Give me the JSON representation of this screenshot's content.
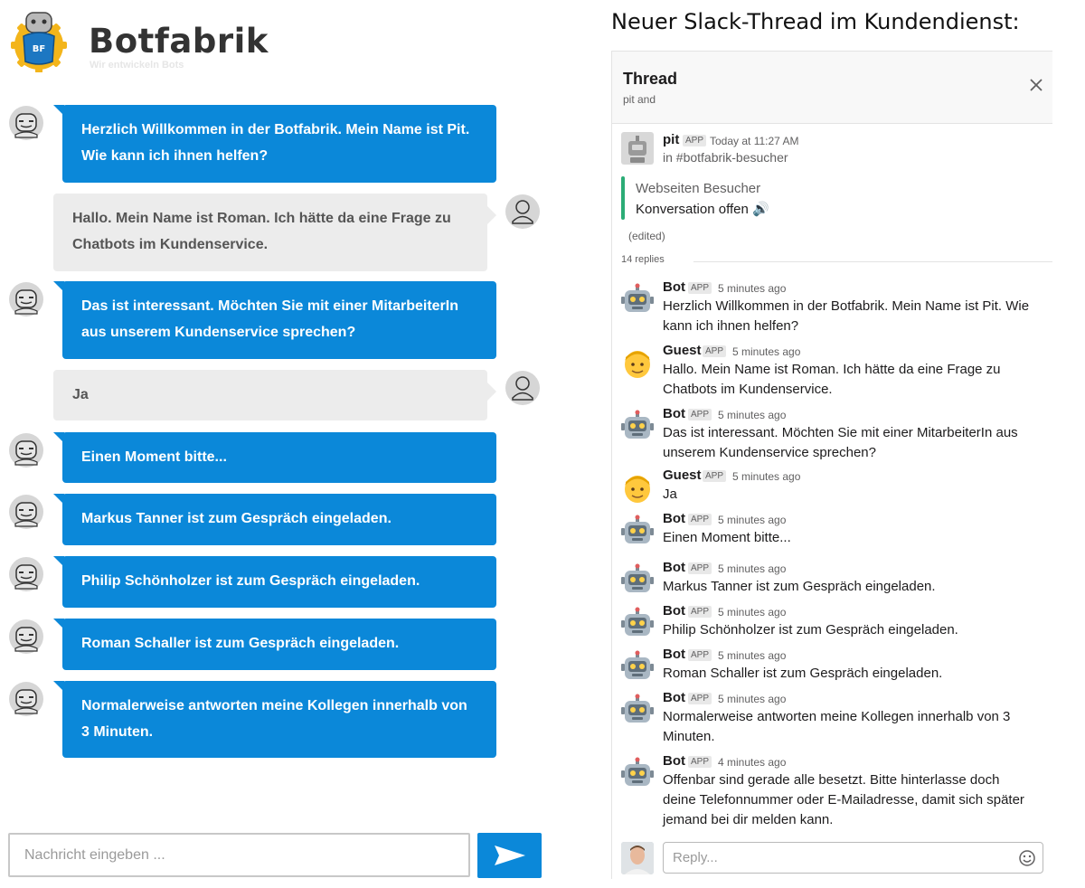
{
  "brand": {
    "name": "Botfabrik",
    "tagline": "Wir entwickeln Bots",
    "logo_text": "BF"
  },
  "chat": {
    "messages": [
      {
        "from": "bot",
        "text": "Herzlich Willkommen in der Botfabrik. Mein Name ist Pit. Wie kann ich ihnen helfen?"
      },
      {
        "from": "user",
        "text": "Hallo. Mein Name ist Roman. Ich hätte da eine Frage zu Chatbots im Kundenservice."
      },
      {
        "from": "bot",
        "text": "Das ist interessant. Möchten Sie mit einer MitarbeiterIn aus unserem Kundenservice sprechen?"
      },
      {
        "from": "user",
        "text": "Ja"
      },
      {
        "from": "bot",
        "text": "Einen Moment bitte..."
      },
      {
        "from": "bot",
        "text": "Markus Tanner ist zum Gespräch eingeladen."
      },
      {
        "from": "bot",
        "text": "Philip Schönholzer ist zum Gespräch eingeladen."
      },
      {
        "from": "bot",
        "text": "Roman Schaller ist zum Gespräch eingeladen."
      },
      {
        "from": "bot",
        "text": "Normalerweise antworten meine Kollegen innerhalb von 3 Minuten."
      }
    ],
    "input_placeholder": "Nachricht eingeben ...",
    "colors": {
      "bot_bubble": "#0b88d9",
      "user_bubble": "#ececec"
    }
  },
  "slack": {
    "heading": "Neuer Slack-Thread im Kundendienst:",
    "thread_title": "Thread",
    "thread_subtitle": "pit and",
    "root": {
      "name": "pit",
      "badge": "APP",
      "time": "Today at 11:27 AM",
      "channel": "in #botfabrik-besucher",
      "attachment_title": "Webseiten Besucher",
      "attachment_text": "Konversation offen 🔊",
      "edited": "(edited)"
    },
    "replies_count": "14 replies",
    "replies": [
      {
        "name": "Bot",
        "badge": "APP",
        "time": "5 minutes ago",
        "avatar": "robot-icon",
        "text": "Herzlich Willkommen in der Botfabrik. Mein Name ist Pit. Wie kann ich ihnen helfen?"
      },
      {
        "name": "Guest",
        "badge": "APP",
        "time": "5 minutes ago",
        "avatar": "guest-face-icon",
        "text": "Hallo. Mein Name ist Roman. Ich hätte da eine Frage zu Chatbots im Kundenservice."
      },
      {
        "name": "Bot",
        "badge": "APP",
        "time": "5 minutes ago",
        "avatar": "robot-icon",
        "text": "Das ist interessant. Möchten Sie mit einer MitarbeiterIn aus unserem Kundenservice sprechen?"
      },
      {
        "name": "Guest",
        "badge": "APP",
        "time": "5 minutes ago",
        "avatar": "guest-face-icon",
        "text": "Ja"
      },
      {
        "name": "Bot",
        "badge": "APP",
        "time": "5 minutes ago",
        "avatar": "robot-icon",
        "text": "Einen Moment bitte..."
      },
      {
        "name": "Bot",
        "badge": "APP",
        "time": "5 minutes ago",
        "avatar": "robot-icon",
        "text": "Markus Tanner ist zum Gespräch eingeladen."
      },
      {
        "name": "Bot",
        "badge": "APP",
        "time": "5 minutes ago",
        "avatar": "robot-icon",
        "text": "Philip Schönholzer ist zum Gespräch eingeladen."
      },
      {
        "name": "Bot",
        "badge": "APP",
        "time": "5 minutes ago",
        "avatar": "robot-icon",
        "text": "Roman Schaller ist zum Gespräch eingeladen."
      },
      {
        "name": "Bot",
        "badge": "APP",
        "time": "5 minutes ago",
        "avatar": "robot-icon",
        "text": "Normalerweise antworten meine Kollegen innerhalb von 3 Minuten."
      },
      {
        "name": "Bot",
        "badge": "APP",
        "time": "4 minutes ago",
        "avatar": "robot-icon",
        "text": "Offenbar sind gerade alle besetzt. Bitte hinterlasse doch deine Telefonnummer oder E-Mailadresse, damit sich später jemand bei dir melden kann."
      }
    ],
    "reply_placeholder": "Reply...",
    "colors": {
      "attachment_bar": "#2bac76"
    }
  }
}
